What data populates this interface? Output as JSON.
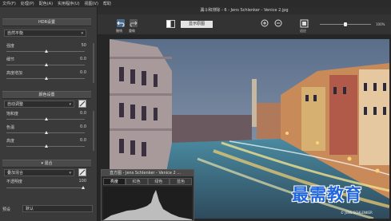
{
  "menu": [
    "文件(F)",
    "处理(P)",
    "配色(A)",
    "实用程序(U)",
    "视图(V)",
    "帮助"
  ],
  "window_title": "漏斗和排除 - 6 - Jens Schlenker - Venice 2.jpg",
  "toolbar": {
    "undo_label": "撤销",
    "redo_label": "重做",
    "compare_label": "显示原图",
    "fit_label": "适应",
    "zoom_value": "100%"
  },
  "panel": {
    "section1": {
      "title": "HDR设置",
      "preset": "自然平衡",
      "sliders": [
        {
          "label": "强度",
          "value": "50"
        },
        {
          "label": "细节",
          "value": "0.0"
        },
        {
          "label": "高度增加",
          "value": "0.0"
        }
      ]
    },
    "section2": {
      "title": "颜色设置",
      "preset": "自动调整",
      "sliders": [
        {
          "label": "饱和度",
          "value": "0.0"
        },
        {
          "label": "色温",
          "value": "0.0"
        },
        {
          "label": "高度",
          "value": "0.0"
        }
      ]
    },
    "section3": {
      "title": "混合",
      "preset": "叠加混合",
      "slider_label": "不透明度",
      "slider_value": "100"
    },
    "preset_label": "预设",
    "preset_value": "默认"
  },
  "histogram": {
    "title": "直方图 - Jens Schlenker - Venice 2 ...",
    "tabs": [
      "亮度",
      "红色",
      "绿色",
      "蓝色"
    ]
  },
  "photo_credit": "© JENS SCHLENKER",
  "watermark": "最需教育"
}
